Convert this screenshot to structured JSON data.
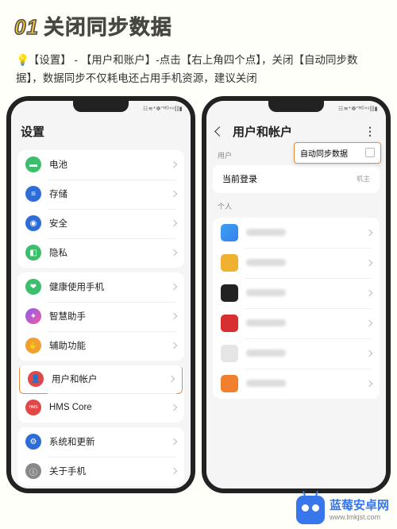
{
  "header": {
    "num": "01",
    "title": "关闭同步数据"
  },
  "description": {
    "bulb": "💡",
    "text_parts": [
      "【设置】",
      " - ",
      "【用户和账户】",
      "-点击",
      "【右上角四个点】",
      "，关闭",
      "【自动同步数据】",
      "，数据同步不仅耗电还占用手机资源，建议关闭"
    ]
  },
  "left_phone": {
    "status": "☷≋*☸\"ᴴᴰ⁴⁶⫿⫿▮",
    "title": "设置",
    "group1": [
      {
        "label": "电池",
        "bg": "#3bbf6c",
        "glyph": "▬"
      },
      {
        "label": "存储",
        "bg": "#2e6cd8",
        "glyph": "≡"
      },
      {
        "label": "安全",
        "bg": "#2e6cd8",
        "glyph": "◉"
      },
      {
        "label": "隐私",
        "bg": "#3bbf6c",
        "glyph": "◧"
      }
    ],
    "group2": [
      {
        "label": "健康使用手机",
        "bg": "#3bbf6c",
        "glyph": "❤"
      },
      {
        "label": "智慧助手",
        "bg": "linear-gradient(135deg,#8a5cf0,#f05ca0)",
        "glyph": "✦"
      },
      {
        "label": "辅助功能",
        "bg": "#f0a030",
        "glyph": "✋"
      }
    ],
    "group3": [
      {
        "label": "用户和帐户",
        "bg": "#e04848",
        "glyph": "👤",
        "highlight": true
      },
      {
        "label": "HMS Core",
        "bg": "#e04848",
        "glyph": "",
        "text": "HMS"
      }
    ],
    "group4": [
      {
        "label": "系统和更新",
        "bg": "#2e6cd8",
        "glyph": "⚙"
      },
      {
        "label": "关于手机",
        "bg": "#888",
        "glyph": "ⓘ"
      }
    ]
  },
  "right_phone": {
    "status": "☷≋*☸\"ᴴᴰ⁴⁶⫿⫿▮",
    "title": "用户和帐户",
    "section_user": "用户",
    "sync_label": "自动同步数据",
    "login_label": "当前登录",
    "login_sub": "机主",
    "section_personal": "个人",
    "apps": [
      {
        "bg": "linear-gradient(135deg,#3aa0f0,#3a80f0)"
      },
      {
        "bg": "#f0b030"
      },
      {
        "bg": "#222"
      },
      {
        "bg": "#d83030"
      },
      {
        "bg": "#e5e5e5"
      },
      {
        "bg": "#f08030"
      }
    ]
  },
  "watermark": {
    "cn": "蓝莓安卓网",
    "en": "www.lmkjst.com"
  }
}
